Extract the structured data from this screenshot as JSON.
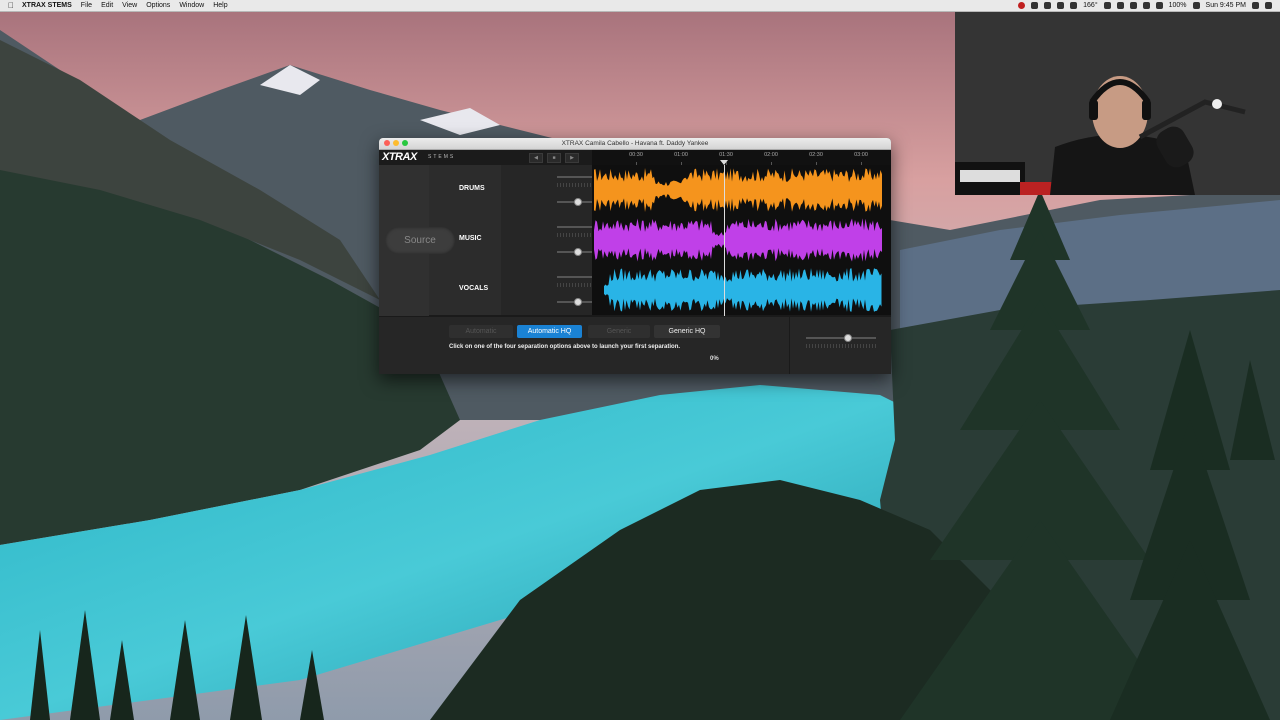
{
  "menubar": {
    "app_name": "XTRAX STEMS",
    "menus": [
      "File",
      "Edit",
      "View",
      "Options",
      "Window",
      "Help"
    ],
    "temperature": "166°",
    "battery": "100%",
    "clock": "Sun 9:45 PM"
  },
  "window": {
    "title": "XTRAX Camila Cabello - Havana ft. Daddy Yankee",
    "logo": "XTRAX",
    "logo_sub": "STEMS"
  },
  "timeline": {
    "ticks": [
      "00:30",
      "01:00",
      "01:30",
      "02:00",
      "02:30",
      "03:00"
    ],
    "playhead_fraction": 0.44
  },
  "source": {
    "label": "Source"
  },
  "tracks": [
    {
      "name": "DRUMS",
      "color": "#f5941d",
      "fader": 0.84
    },
    {
      "name": "MUSIC",
      "color": "#c040e8",
      "fader": 0.84
    },
    {
      "name": "VOCALS",
      "color": "#29b4e6",
      "fader": 0.84
    }
  ],
  "separation": {
    "options": [
      {
        "label": "Automatic",
        "state": "disabled"
      },
      {
        "label": "Automatic HQ",
        "state": "active"
      },
      {
        "label": "Generic",
        "state": "disabled"
      },
      {
        "label": "Generic HQ",
        "state": "normal"
      }
    ],
    "hint": "Click on one of the four separation options above to launch your first separation.",
    "progress": "0%"
  },
  "colors": {
    "accent": "#1a82d4"
  },
  "icons": [
    "apple-icon",
    "wifi-icon",
    "search-icon",
    "battery-icon",
    "mute-icon",
    "solo-icon"
  ]
}
